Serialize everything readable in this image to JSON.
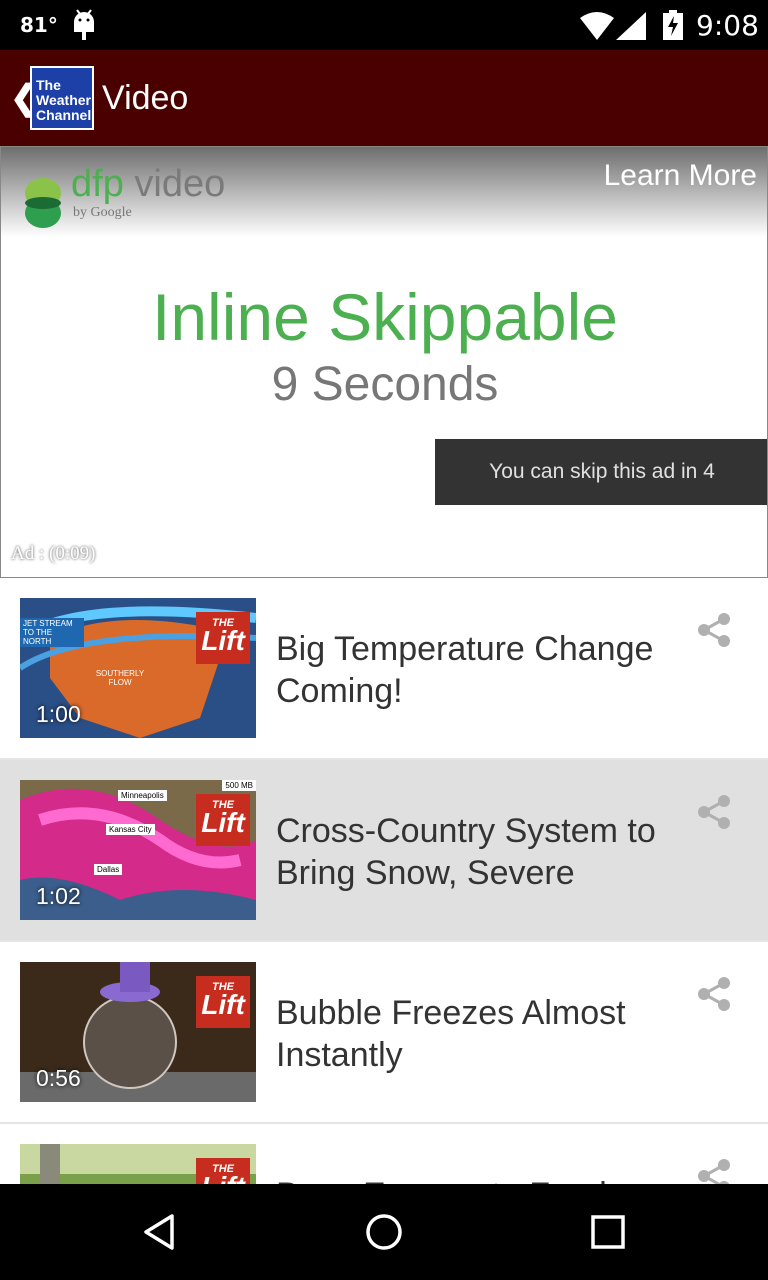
{
  "status_bar": {
    "temperature": "81°",
    "time": "9:08"
  },
  "app_bar": {
    "back_glyph": "❮",
    "logo_lines": [
      "The",
      "Weather",
      "Channel"
    ],
    "title": "Video"
  },
  "ad": {
    "brand_dfp": "dfp",
    "brand_video": " video",
    "brand_sub": "by Google",
    "learn_more": "Learn More",
    "headline": "Inline Skippable",
    "subheadline": "9 Seconds",
    "skip_text": "You can skip this ad in 4",
    "timer": "Ad : (0:09)"
  },
  "videos": [
    {
      "title": "Big Temperature Change Coming!",
      "duration": "1:00",
      "badge_the": "THE",
      "badge_lift": "Lift",
      "map_labels": [
        "JET STREAM TO THE NORTH",
        "SOUTHERLY FLOW"
      ]
    },
    {
      "title": "Cross-Country System to Bring Snow, Severe",
      "duration": "1:02",
      "badge_the": "THE",
      "badge_lift": "Lift",
      "map_labels": [
        "Minneapolis",
        "Kansas City",
        "Dallas",
        "500 MB"
      ]
    },
    {
      "title": "Bubble Freezes Almost Instantly",
      "duration": "0:56",
      "badge_the": "THE",
      "badge_lift": "Lift"
    },
    {
      "title": "Bees Emerge to Feed",
      "duration": "",
      "badge_the": "THE",
      "badge_lift": "Lift"
    }
  ],
  "colors": {
    "app_bar": "#4b0000",
    "ad_headline": "#4caf50",
    "lift_badge": "#c62d1f"
  }
}
